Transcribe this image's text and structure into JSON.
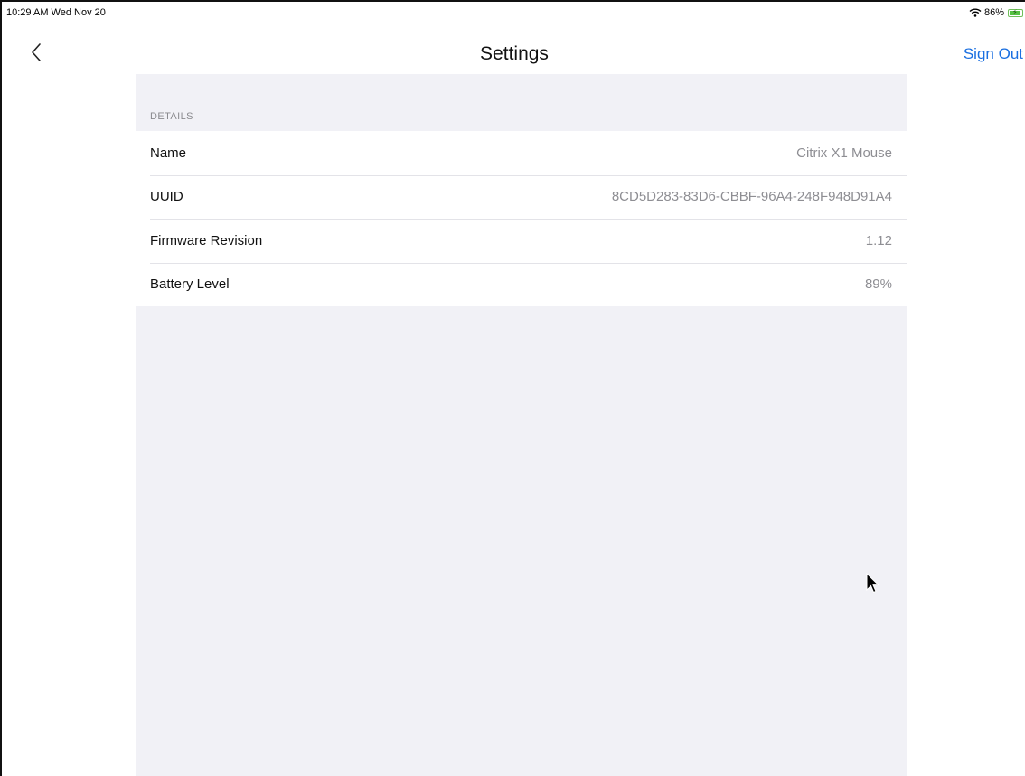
{
  "status_bar": {
    "time": "10:29 AM  Wed Nov 20",
    "battery_percent": "86%",
    "battery_level": 0.86,
    "wifi_icon": "wifi-icon",
    "battery_icon": "battery-charging-icon"
  },
  "nav": {
    "back_icon": "chevron-left-icon",
    "title": "Settings",
    "sign_out_label": "Sign Out"
  },
  "details": {
    "header": "DETAILS",
    "rows": [
      {
        "label": "Name",
        "value": "Citrix X1 Mouse"
      },
      {
        "label": "UUID",
        "value": "8CD5D283-83D6-CBBF-96A4-248F948D91A4"
      },
      {
        "label": "Firmware Revision",
        "value": "1.12"
      },
      {
        "label": "Battery Level",
        "value": "89%"
      }
    ]
  },
  "colors": {
    "accent": "#1a6fe0",
    "background_grouped": "#f1f1f6",
    "secondary_text": "#8e8e93"
  }
}
